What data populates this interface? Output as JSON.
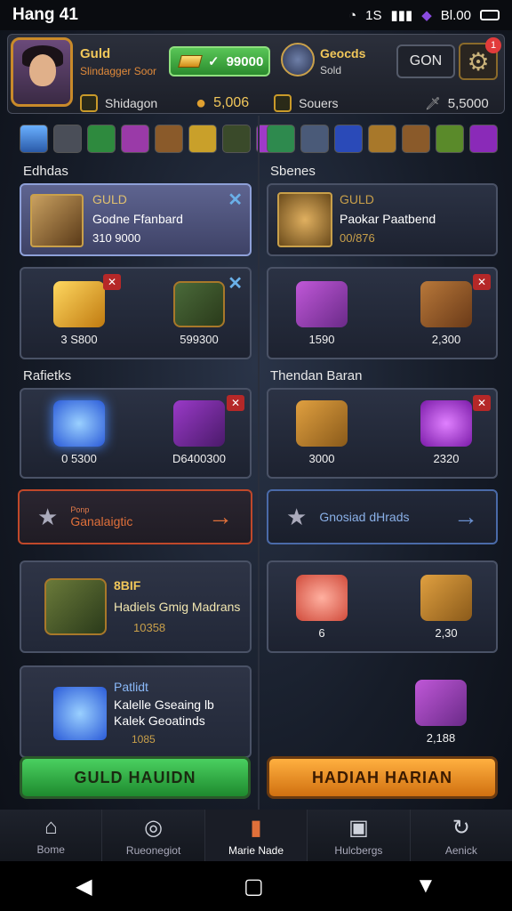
{
  "status": {
    "time": "Hang 41",
    "signal": "1S",
    "battery": "Bl.00"
  },
  "header": {
    "title": "Guld",
    "subtitle": "Slindagger Soor",
    "gold_value": "99000",
    "emblem_title": "Geocds",
    "emblem_sub": "Sold",
    "gon_label": "GON",
    "notif_count": "1"
  },
  "resources": {
    "left_label": "Shidagon",
    "mid_value": "5,006",
    "mid_label": "Souers",
    "right_value": "5,5000"
  },
  "sections": {
    "left_top": "Edhdas",
    "right_top": "Sbenes",
    "left_mid": "Rafietks",
    "right_mid": "Thendan Baran"
  },
  "featured": {
    "tag": "GULD",
    "title": "Godne Ffanbard",
    "value": "310 9000",
    "right_tag": "GULD",
    "right_title": "Paokar Paatbend",
    "right_value": "00/876"
  },
  "grid": {
    "r1l_a": "3 S800",
    "r1l_b": "599300",
    "r1r_a": "1590",
    "r1r_b": "2,300",
    "r2l_a": "0 5300",
    "r2l_b": "D6400300",
    "r2r_a": "3000",
    "r2r_b": "2320"
  },
  "rewards": {
    "left_label": "Ganalaigtic",
    "left_sub": "Ponp",
    "right_label": "Gnosiad dHrads"
  },
  "promo1": {
    "tag": "8BIF",
    "title": "Hadiels Gmig Madrans",
    "value": "10358"
  },
  "promo2": {
    "tag": "Patlidt",
    "title": "Kalelle Gseaing lb",
    "title2": "Kalek Geoatinds",
    "value": "1085"
  },
  "right_low": {
    "a": "6",
    "b": "2,30",
    "c": "2,188"
  },
  "buttons": {
    "left": "GULD HAUIDN",
    "right": "HADIAH HARIAN"
  },
  "nav": [
    {
      "label": "Bome",
      "icon": "home-icon"
    },
    {
      "label": "Rueonegiot",
      "icon": "settings-icon"
    },
    {
      "label": "Marie Nade",
      "icon": "card-icon"
    },
    {
      "label": "Hulcbergs",
      "icon": "chest-icon"
    },
    {
      "label": "Aenick",
      "icon": "refresh-icon"
    }
  ],
  "colors": {
    "green": "#3aa844",
    "orange": "#e08a1e",
    "accent_red": "#d0432a",
    "accent_blue": "#5a78b8"
  }
}
